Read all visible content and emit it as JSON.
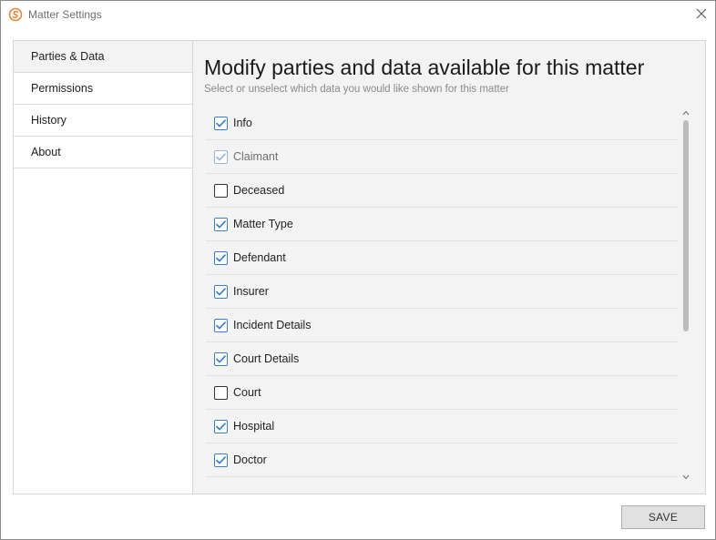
{
  "window": {
    "title": "Matter Settings",
    "app_icon": "matter-app-logo-icon",
    "close_icon": "close-icon",
    "accent_color": "#e8843a"
  },
  "sidebar": {
    "items": [
      {
        "label": "Parties & Data",
        "active": true
      },
      {
        "label": "Permissions",
        "active": false
      },
      {
        "label": "History",
        "active": false
      },
      {
        "label": "About",
        "active": false
      }
    ]
  },
  "main": {
    "heading": "Modify parties and data available for this matter",
    "subheading": "Select or unselect which data you would like shown for this matter",
    "checkbox_color": "#3c7dd4",
    "items": [
      {
        "label": "Info",
        "checked": true,
        "disabled": false
      },
      {
        "label": "Claimant",
        "checked": true,
        "disabled": true
      },
      {
        "label": "Deceased",
        "checked": false,
        "disabled": false
      },
      {
        "label": "Matter Type",
        "checked": true,
        "disabled": false
      },
      {
        "label": "Defendant",
        "checked": true,
        "disabled": false
      },
      {
        "label": "Insurer",
        "checked": true,
        "disabled": false
      },
      {
        "label": "Incident Details",
        "checked": true,
        "disabled": false
      },
      {
        "label": "Court Details",
        "checked": true,
        "disabled": false
      },
      {
        "label": "Court",
        "checked": false,
        "disabled": false
      },
      {
        "label": "Hospital",
        "checked": true,
        "disabled": false
      },
      {
        "label": "Doctor",
        "checked": true,
        "disabled": false
      }
    ]
  },
  "footer": {
    "save_label": "SAVE"
  }
}
